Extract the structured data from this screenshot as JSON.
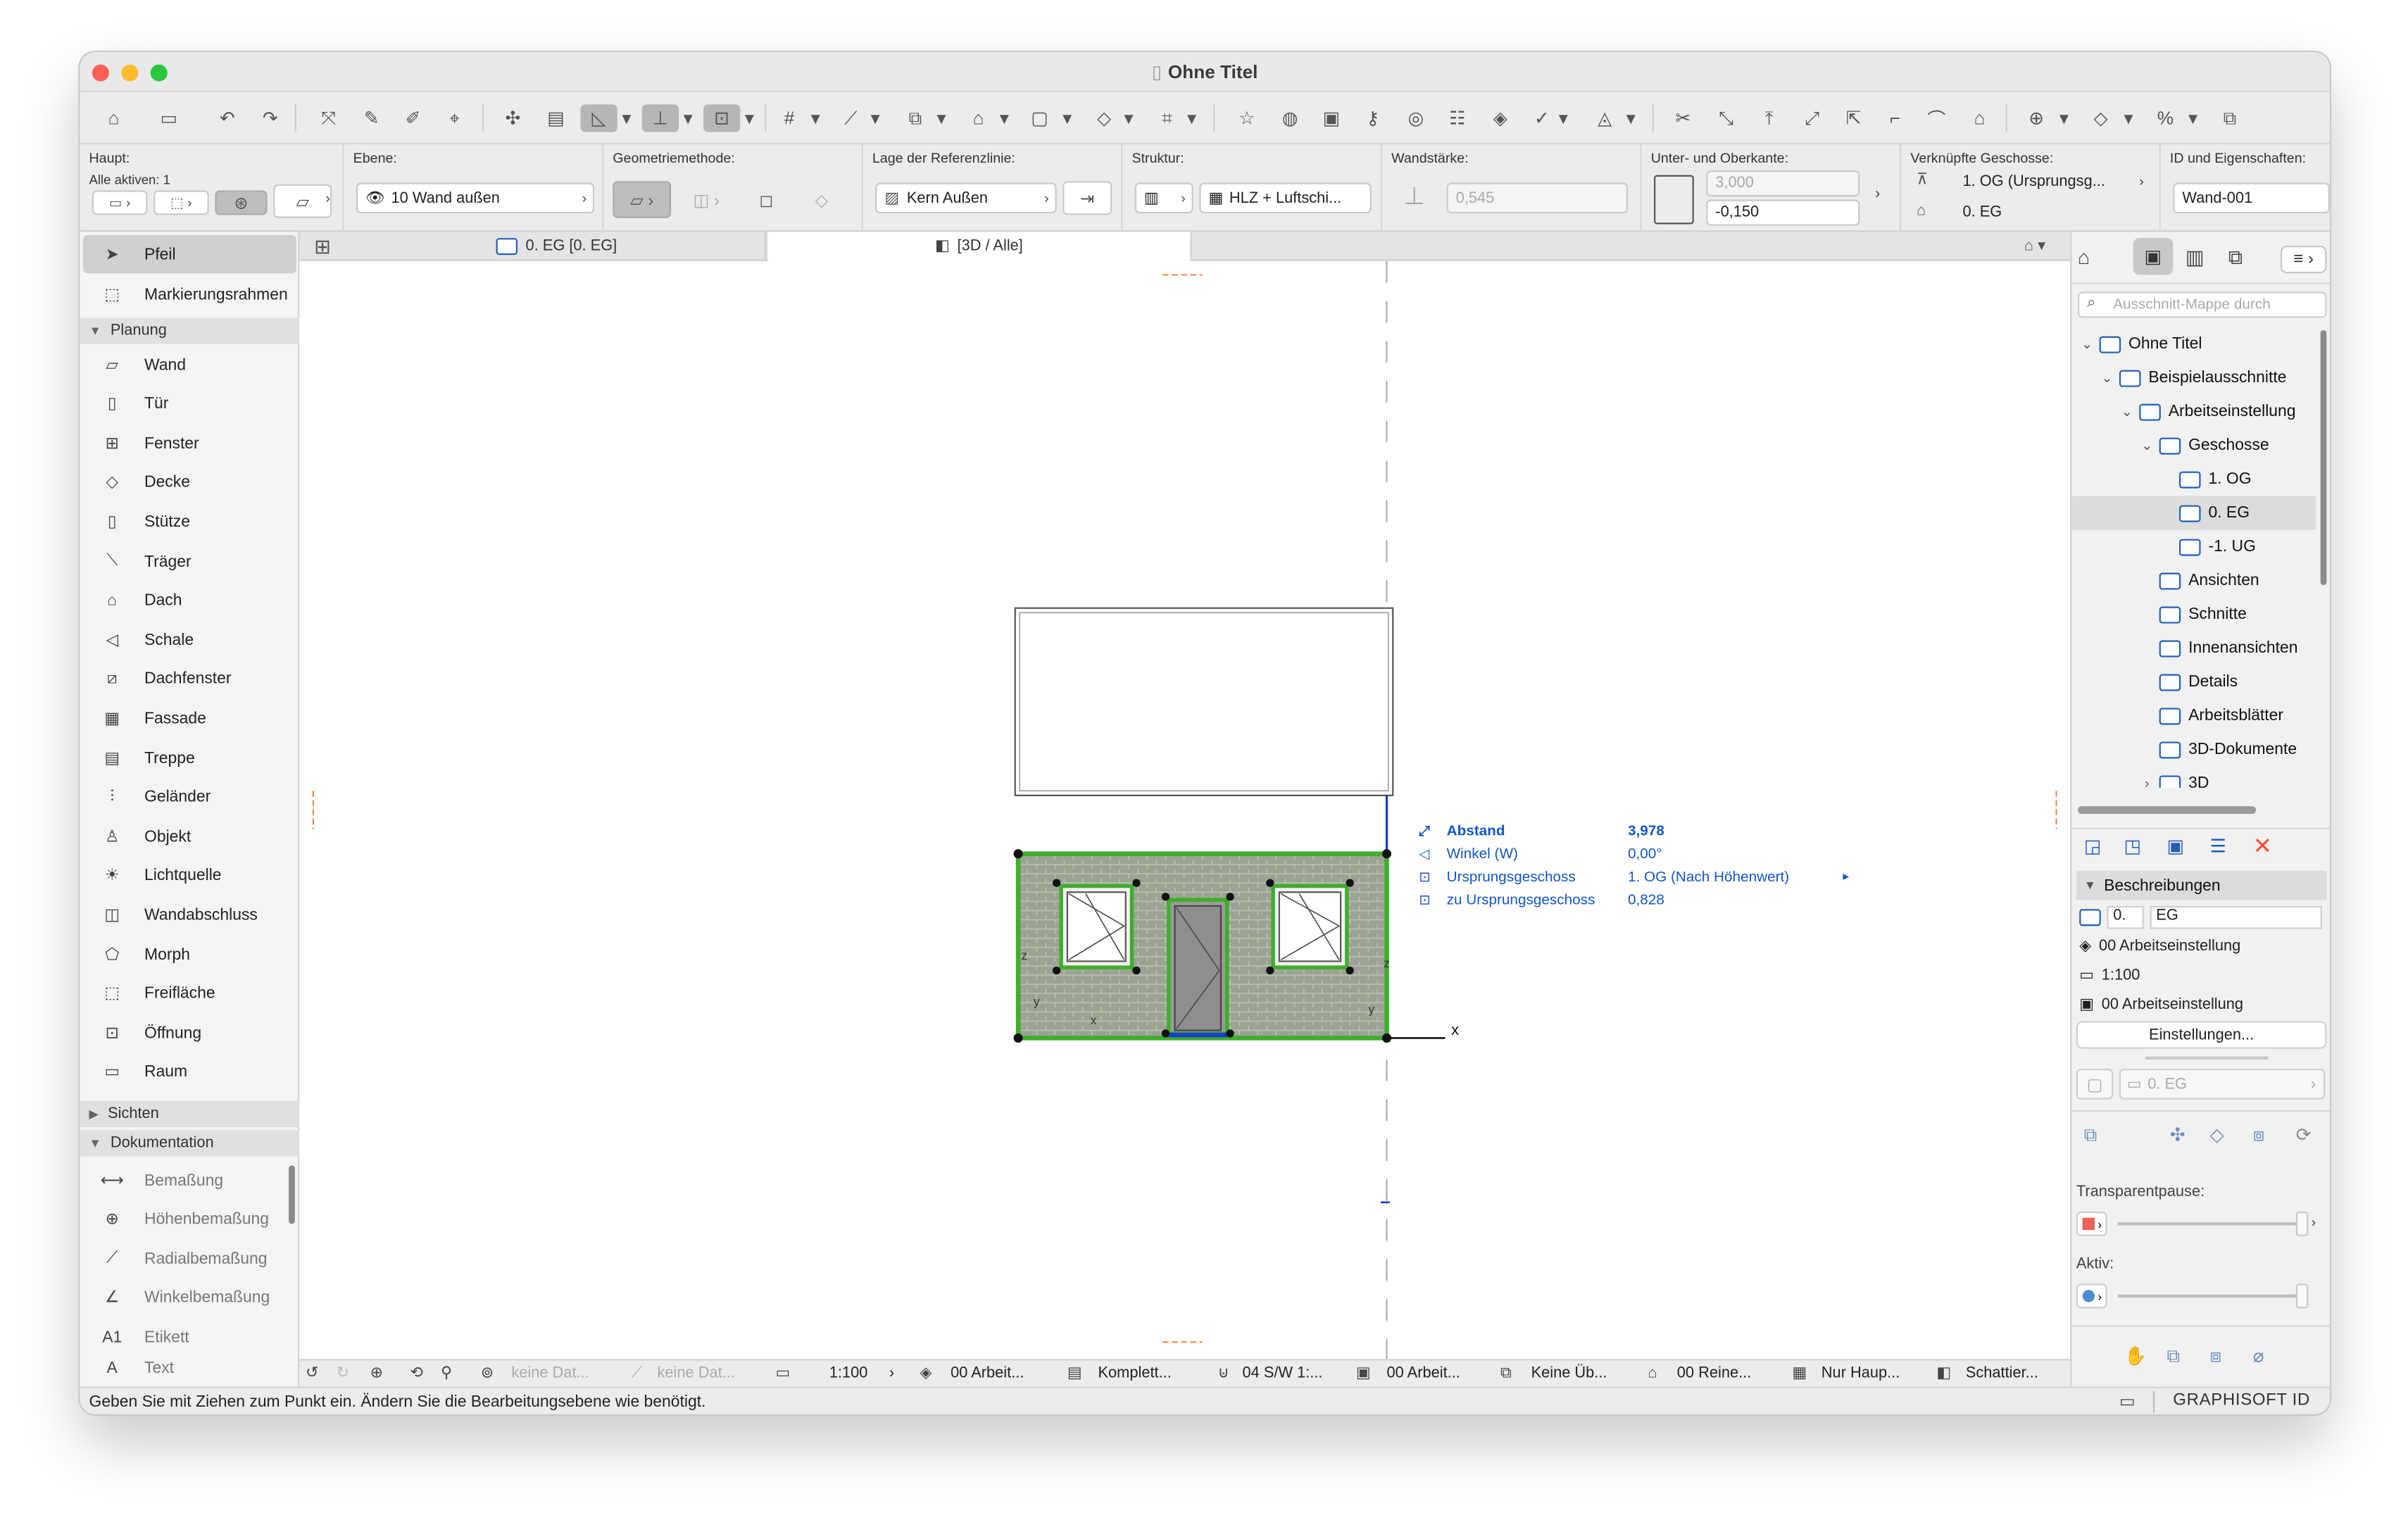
{
  "window": {
    "title": "Ohne Titel"
  },
  "info_box": {
    "haupt_label": "Haupt:",
    "alle_aktiven": "Alle aktiven: 1",
    "ebene_label": "Ebene:",
    "ebene_value": "10 Wand außen",
    "geometrie_label": "Geometriemethode:",
    "referenz_label": "Lage der Referenzlinie:",
    "referenz_value": "Kern Außen",
    "struktur_label": "Struktur:",
    "struktur_value": "HLZ + Luftschi...",
    "wandstaerke_label": "Wandstärke:",
    "wandstaerke_value": "0,545",
    "kante_label": "Unter- und Oberkante:",
    "oberkante_value": "3,000",
    "unterkante_value": "-0,150",
    "geschosse_label": "Verknüpfte Geschosse:",
    "geschoss_oben": "1. OG (Ursprungsg...",
    "geschoss_unten": "0. EG",
    "id_label": "ID und Eigenschaften:",
    "id_value": "Wand-001"
  },
  "toolbox": {
    "pfeil": "Pfeil",
    "markierungsrahmen": "Markierungsrahmen",
    "section_planung": "Planung",
    "planung_items": [
      "Wand",
      "Tür",
      "Fenster",
      "Decke",
      "Stütze",
      "Träger",
      "Dach",
      "Schale",
      "Dachfenster",
      "Fassade",
      "Treppe",
      "Geländer",
      "Objekt",
      "Lichtquelle",
      "Wandabschluss",
      "Morph",
      "Freifläche",
      "Öffnung",
      "Raum"
    ],
    "section_sichten": "Sichten",
    "section_dokumentation": "Dokumentation",
    "dok_items": [
      "Bemaßung",
      "Höhenbemaßung",
      "Radialbemaßung",
      "Winkelbemaßung",
      "Etikett",
      "Text"
    ]
  },
  "tabs": {
    "tab1": "0. EG [0. EG]",
    "tab2": "[3D / Alle]"
  },
  "tracker": {
    "rows": [
      {
        "label": "Abstand",
        "value": "3,978"
      },
      {
        "label": "Winkel (W)",
        "value": "0,00°"
      },
      {
        "label": "Ursprungsgeschoss",
        "value": "1. OG (Nach Höhenwert)"
      },
      {
        "label": "zu Ursprungsgeschoss",
        "value": "0,828"
      }
    ]
  },
  "axes": {
    "x": "x",
    "y": "y",
    "z": "z"
  },
  "navigator": {
    "search_placeholder": "Ausschnitt-Mappe durch",
    "items": [
      {
        "label": "Ohne Titel",
        "indent": 0,
        "arrow": "⌄"
      },
      {
        "label": "Beispielausschnitte",
        "indent": 1,
        "arrow": "⌄"
      },
      {
        "label": "Arbeitseinstellung",
        "indent": 2,
        "arrow": "⌄"
      },
      {
        "label": "Geschosse",
        "indent": 3,
        "arrow": "⌄"
      },
      {
        "label": "1. OG",
        "indent": 4,
        "arrow": ""
      },
      {
        "label": "0. EG",
        "indent": 4,
        "arrow": ""
      },
      {
        "label": "-1. UG",
        "indent": 4,
        "arrow": ""
      },
      {
        "label": "Ansichten",
        "indent": 3,
        "arrow": ""
      },
      {
        "label": "Schnitte",
        "indent": 3,
        "arrow": ""
      },
      {
        "label": "Innenansichten",
        "indent": 3,
        "arrow": ""
      },
      {
        "label": "Details",
        "indent": 3,
        "arrow": ""
      },
      {
        "label": "Arbeitsblätter",
        "indent": 3,
        "arrow": ""
      },
      {
        "label": "3D-Dokumente",
        "indent": 3,
        "arrow": ""
      },
      {
        "label": "3D",
        "indent": 3,
        "arrow": "›"
      }
    ],
    "selected_item": "0. EG"
  },
  "properties": {
    "section": "Beschreibungen",
    "nr": "0.",
    "name": "EG",
    "layer": "00 Arbeitseinstellung",
    "scale": "1:100",
    "model": "00 Arbeitseinstellung",
    "settings_button": "Einstellungen...",
    "floor_field": "0. EG",
    "transparent_label": "Transparentpause:",
    "aktiv_label": "Aktiv:"
  },
  "bottom_bar": {
    "item1": "keine Dat...",
    "item2": "keine Dat...",
    "scale": "1:100",
    "layers": "00 Arbeit...",
    "structure": "Komplett...",
    "pen": "04 S/W 1:...",
    "model": "00 Arbeit...",
    "override": "Keine Üb...",
    "renovation": "00 Reine...",
    "partial": "Nur Haup...",
    "shading": "Schattier..."
  },
  "status": {
    "message": "Geben Sie mit Ziehen zum Punkt ein. Ändern Sie die Bearbeitungsebene wie benötigt.",
    "brand": "GRAPHISOFT ID"
  },
  "colors": {
    "wall_green": "#3fae2a",
    "tracker_blue": "#1456c8",
    "brick": "#9aa394",
    "close_red": "#ff5f57",
    "min_yellow": "#febc2e",
    "max_green": "#28c840"
  }
}
